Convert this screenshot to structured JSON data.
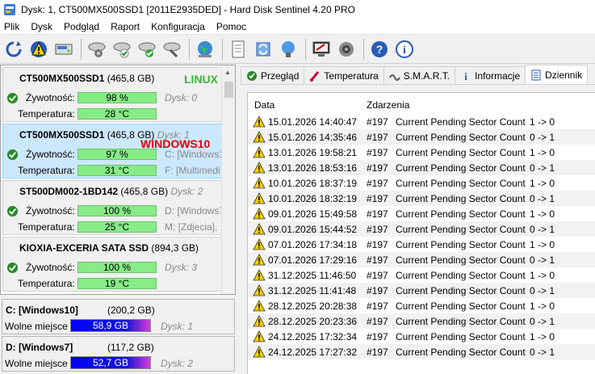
{
  "window": {
    "title": "Dysk: 1, CT500MX500SSD1 [2011E2935DED]  -  Hard Disk Sentinel 4.20 PRO"
  },
  "menu": [
    "Plik",
    "Dysk",
    "Podgląd",
    "Raport",
    "Konfiguracja",
    "Pomoc"
  ],
  "toolbar": {
    "icons": [
      "refresh-icon",
      "warning-alert-icon",
      "disk-icon",
      "disk-tool-1-icon",
      "disk-tool-2-icon",
      "disk-tool-3-icon",
      "disk-tool-4-icon",
      "globe-icon",
      "report-icon",
      "sync-icon",
      "network-icon",
      "monitor-icon",
      "sound-icon",
      "help-icon",
      "info-icon"
    ]
  },
  "disks": [
    {
      "name": "CT500MX500SSD1",
      "size": "(465,8 GB)",
      "dysk": "",
      "os_label": "LINUX",
      "os_color": "#33b933",
      "health_label": "Żywotność:",
      "health": "98 %",
      "health_pct": 98,
      "temp_label": "Temperatura:",
      "temp": "28 °C",
      "side1": "Dysk: 0",
      "side2": ""
    },
    {
      "name": "CT500MX500SSD1",
      "size": "(465,8 GB)",
      "dysk": "Dysk: 1",
      "os_label": "WINDOWS10",
      "os_color": "#e00000",
      "health_label": "Żywotność:",
      "health": "97 %",
      "health_pct": 97,
      "temp_label": "Temperatura:",
      "temp": "31 °C",
      "side1": "C: [Windows1",
      "side2": "F: [Multimedi"
    },
    {
      "name": "ST500DM002-1BD142",
      "size": "(465,8 GB)",
      "dysk": "Dysk: 2",
      "os_label": "",
      "os_color": "",
      "health_label": "Żywotność:",
      "health": "100 %",
      "health_pct": 100,
      "temp_label": "Temperatura:",
      "temp": "25 °C",
      "side1": "D: [Windows7",
      "side2": "M: [Zdjecia], "
    },
    {
      "name": "KIOXIA-EXCERIA SATA SSD",
      "size": "(894,3 GB)",
      "dysk": "",
      "os_label": "",
      "os_color": "",
      "health_label": "Żywotność:",
      "health": "100 %",
      "health_pct": 100,
      "temp_label": "Temperatura:",
      "temp": "19 °C",
      "side1": "Dysk: 3",
      "side2": ""
    }
  ],
  "partitions": [
    {
      "name": "C: [Windows10]",
      "size": "(200,2 GB)",
      "free_label": "Wolne miejsce",
      "free": "58,9 GB",
      "dysk": "Dysk: 1"
    },
    {
      "name": "D: [Windows7]",
      "size": "(117,2 GB)",
      "free_label": "Wolne miejsce",
      "free": "52,7 GB",
      "dysk": "Dysk: 2"
    }
  ],
  "tabs": [
    {
      "label": "Przegląd",
      "icon": "check-icon",
      "active": false
    },
    {
      "label": "Temperatura",
      "icon": "thermometer-icon",
      "active": false
    },
    {
      "label": "S.M.A.R.T.",
      "icon": "smart-icon",
      "active": false
    },
    {
      "label": "Informacje",
      "icon": "info-icon",
      "active": false
    },
    {
      "label": "Dziennik",
      "icon": "log-icon",
      "active": true
    }
  ],
  "log": {
    "col_date": "Data",
    "col_event": "Zdarzenia",
    "rows": [
      {
        "date": "15.01.2026 14:40:47",
        "code": "#197",
        "desc": "Current Pending Sector Count",
        "val": "1 -> 0"
      },
      {
        "date": "15.01.2026 14:35:46",
        "code": "#197",
        "desc": "Current Pending Sector Count",
        "val": "0 -> 1"
      },
      {
        "date": "13.01.2026 19:58:21",
        "code": "#197",
        "desc": "Current Pending Sector Count",
        "val": "1 -> 0"
      },
      {
        "date": "13.01.2026 18:53:16",
        "code": "#197",
        "desc": "Current Pending Sector Count",
        "val": "0 -> 1"
      },
      {
        "date": "10.01.2026 18:37:19",
        "code": "#197",
        "desc": "Current Pending Sector Count",
        "val": "1 -> 0"
      },
      {
        "date": "10.01.2026 18:32:19",
        "code": "#197",
        "desc": "Current Pending Sector Count",
        "val": "0 -> 1"
      },
      {
        "date": "09.01.2026 15:49:58",
        "code": "#197",
        "desc": "Current Pending Sector Count",
        "val": "1 -> 0"
      },
      {
        "date": "09.01.2026 15:44:52",
        "code": "#197",
        "desc": "Current Pending Sector Count",
        "val": "0 -> 1"
      },
      {
        "date": "07.01.2026 17:34:18",
        "code": "#197",
        "desc": "Current Pending Sector Count",
        "val": "1 -> 0"
      },
      {
        "date": "07.01.2026 17:29:16",
        "code": "#197",
        "desc": "Current Pending Sector Count",
        "val": "0 -> 1"
      },
      {
        "date": "31.12.2025 11:46:50",
        "code": "#197",
        "desc": "Current Pending Sector Count",
        "val": "1 -> 0"
      },
      {
        "date": "31.12.2025 11:41:48",
        "code": "#197",
        "desc": "Current Pending Sector Count",
        "val": "0 -> 1"
      },
      {
        "date": "28.12.2025 20:28:38",
        "code": "#197",
        "desc": "Current Pending Sector Count",
        "val": "1 -> 0"
      },
      {
        "date": "28.12.2025 20:23:36",
        "code": "#197",
        "desc": "Current Pending Sector Count",
        "val": "0 -> 1"
      },
      {
        "date": "24.12.2025 17:32:34",
        "code": "#197",
        "desc": "Current Pending Sector Count",
        "val": "1 -> 0"
      },
      {
        "date": "24.12.2025 17:27:32",
        "code": "#197",
        "desc": "Current Pending Sector Count",
        "val": "0 -> 1"
      }
    ]
  }
}
